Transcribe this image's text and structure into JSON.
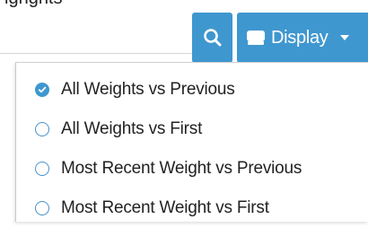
{
  "header": {
    "partial_text": "ighghts",
    "search_icon": "search-icon",
    "display_button": {
      "label": "Display",
      "icon": "monitor-icon",
      "caret_icon": "caret-down-icon"
    }
  },
  "colors": {
    "accent": "#3f97cf",
    "text": "#222222",
    "menu_border": "#c9c9c9"
  },
  "menu": {
    "items": [
      {
        "label": "All Weights vs Previous",
        "checked": true
      },
      {
        "label": "All Weights vs First",
        "checked": false
      },
      {
        "label": "Most Recent Weight vs Previous",
        "checked": false
      },
      {
        "label": "Most Recent Weight vs First",
        "checked": false
      }
    ]
  }
}
